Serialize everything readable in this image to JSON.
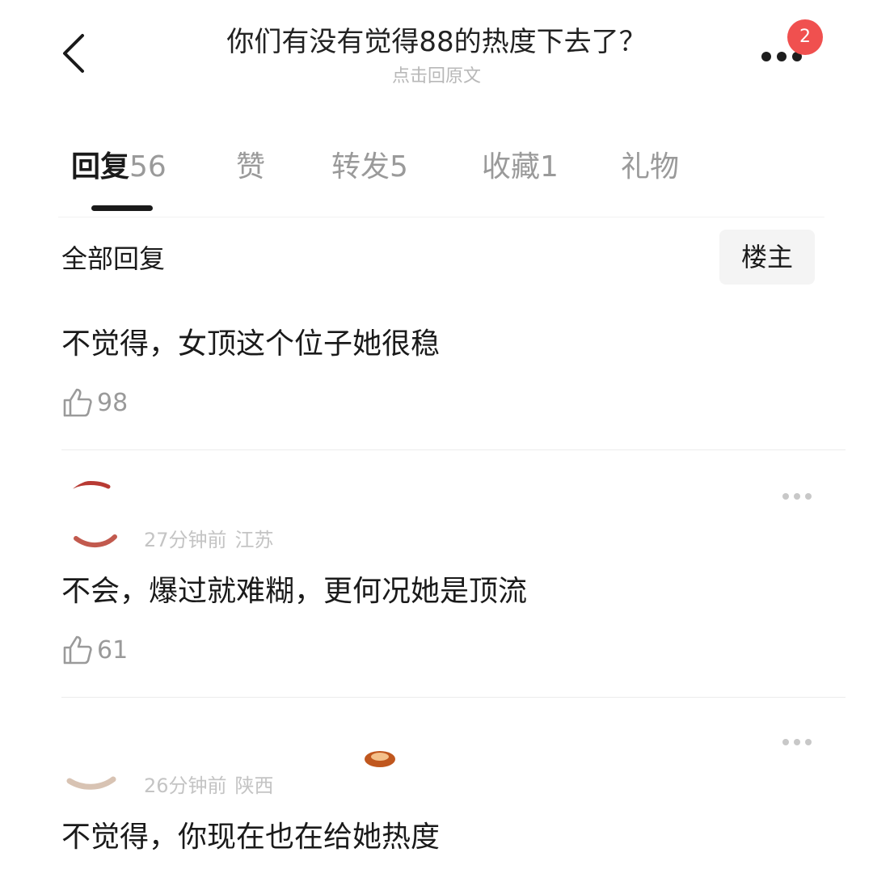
{
  "header": {
    "title": "你们有没有觉得88的热度下去了？",
    "subtitle": "点击回原文",
    "notification_count": "2"
  },
  "tabs": [
    {
      "label": "回复",
      "count": "56"
    },
    {
      "label": "赞",
      "count": ""
    },
    {
      "label": "转发",
      "count": "5"
    },
    {
      "label": "收藏",
      "count": "1"
    },
    {
      "label": "礼物",
      "count": ""
    }
  ],
  "section": {
    "title": "全部回复",
    "filter_label": "楼主"
  },
  "comments": [
    {
      "text": "不觉得，女顶这个位子她很稳",
      "likes": "98"
    },
    {
      "time": "27分钟前",
      "location": "江苏",
      "text": "不会，爆过就难糊，更何况她是顶流",
      "likes": "61"
    },
    {
      "time": "26分钟前",
      "location": "陕西",
      "text": "不觉得，你现在也在给她热度"
    }
  ],
  "colors": {
    "badge": "#f0504f",
    "text_primary": "#1a1a1a",
    "text_secondary": "#9a9a9a"
  },
  "icons": [
    "back-arrow-icon",
    "more-icon",
    "thumbs-up-icon"
  ]
}
